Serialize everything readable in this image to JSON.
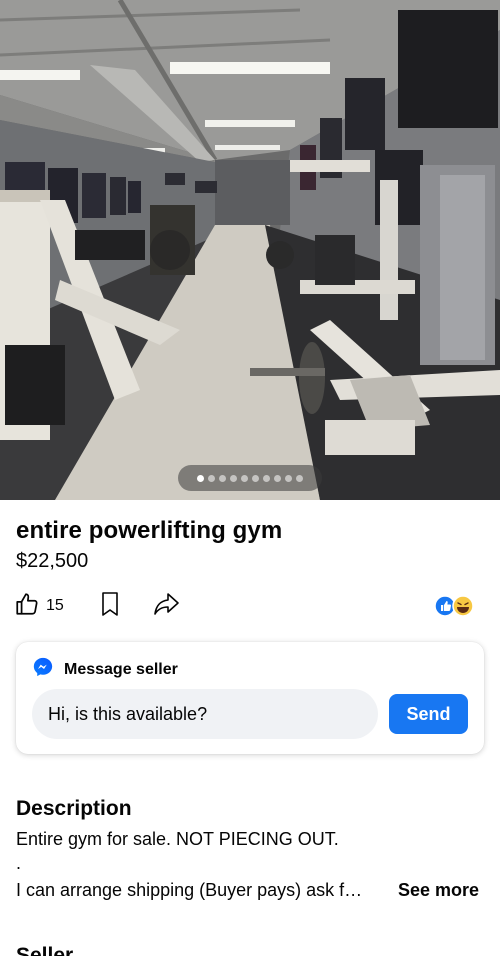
{
  "listing": {
    "title": "entire powerlifting gym",
    "price": "$22,500",
    "photo": {
      "slide_count": 10,
      "active_index": 0
    }
  },
  "actions": {
    "like_count": "15",
    "like_icon": "thumbs-up-icon",
    "save_icon": "bookmark-icon",
    "share_icon": "share-icon",
    "reactions": [
      "like-reaction",
      "laugh-reaction"
    ]
  },
  "message": {
    "header": "Message seller",
    "icon": "messenger-icon",
    "input_value": "Hi, is this available?",
    "send_label": "Send"
  },
  "description": {
    "heading": "Description",
    "line1": "Entire gym for sale. NOT PIECING OUT.",
    "line2": ".",
    "line3": "I can arrange shipping (Buyer pays) ask f…",
    "see_more": "See more"
  },
  "seller": {
    "heading": "Seller"
  },
  "colors": {
    "accent": "#1877f2",
    "input_bg": "#f0f2f5",
    "text": "#050505"
  }
}
